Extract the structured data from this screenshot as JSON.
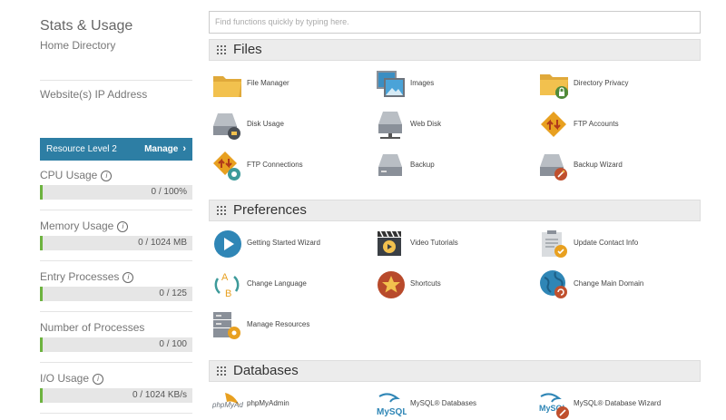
{
  "left": {
    "stats_title": "Stats & Usage",
    "home_directory": "Home Directory",
    "ip_label": "Website(s) IP Address",
    "resource_level": "Resource Level 2",
    "manage_label": "Manage",
    "stats": [
      {
        "label": "CPU Usage",
        "value": "0 / 100%",
        "used_fraction": 0
      },
      {
        "label": "Memory Usage",
        "value": "0 / 1024 MB",
        "used_fraction": 0
      },
      {
        "label": "Entry Processes",
        "value": "0 / 125",
        "used_fraction": 0
      },
      {
        "label": "Number of Processes",
        "value": "0 / 100",
        "used_fraction": 0
      },
      {
        "label": "I/O Usage",
        "value": "0 / 1024 KB/s",
        "used_fraction": 0
      }
    ]
  },
  "search": {
    "placeholder": "Find functions quickly by typing here."
  },
  "sections": {
    "files": {
      "title": "Files",
      "items": [
        {
          "label": "File Manager",
          "icon": "folder-icon"
        },
        {
          "label": "Images",
          "icon": "images-icon"
        },
        {
          "label": "Directory Privacy",
          "icon": "folder-lock-icon"
        },
        {
          "label": "Disk Usage",
          "icon": "disk-usage-icon"
        },
        {
          "label": "Web Disk",
          "icon": "web-disk-icon"
        },
        {
          "label": "FTP Accounts",
          "icon": "ftp-accounts-icon"
        },
        {
          "label": "FTP Connections",
          "icon": "ftp-connections-icon"
        },
        {
          "label": "Backup",
          "icon": "backup-icon"
        },
        {
          "label": "Backup Wizard",
          "icon": "backup-wizard-icon"
        }
      ]
    },
    "preferences": {
      "title": "Preferences",
      "items": [
        {
          "label": "Getting Started Wizard",
          "icon": "play-icon"
        },
        {
          "label": "Video Tutorials",
          "icon": "video-icon"
        },
        {
          "label": "Update Contact Info",
          "icon": "contact-info-icon"
        },
        {
          "label": "Change Language",
          "icon": "language-icon"
        },
        {
          "label": "Shortcuts",
          "icon": "star-icon"
        },
        {
          "label": "Change Main Domain",
          "icon": "globe-icon"
        },
        {
          "label": "Manage Resources",
          "icon": "server-gear-icon"
        }
      ]
    },
    "databases": {
      "title": "Databases",
      "items": [
        {
          "label": "phpMyAdmin",
          "icon": "phpmyadmin-icon",
          "logo_text": "phpMyAdmin"
        },
        {
          "label": "MySQL® Databases",
          "icon": "mysql-icon",
          "logo_text": "MySQL"
        },
        {
          "label": "MySQL® Database Wizard",
          "icon": "mysql-wizard-icon",
          "logo_text": "MySQL"
        }
      ]
    }
  },
  "colors": {
    "accent_blue": "#2d7ea4",
    "usage_green": "#6db33f",
    "folder_yellow": "#f2c14e",
    "ftp_orange": "#e8a020",
    "icon_gray": "#8a9099"
  }
}
